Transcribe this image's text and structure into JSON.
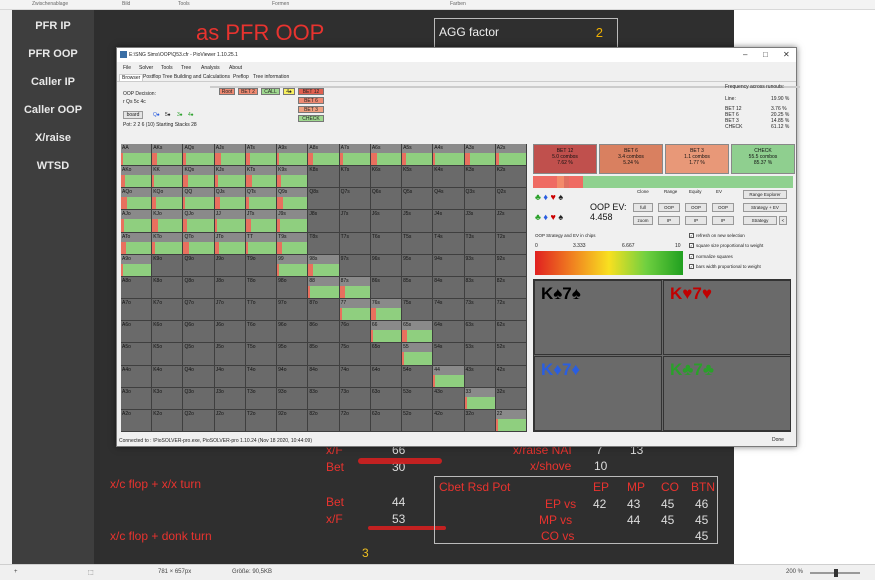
{
  "ribbon": {
    "items": [
      "Zwischenablage",
      "Bild",
      "Tools",
      "Formen",
      "Farben"
    ]
  },
  "left_nav": {
    "items": [
      "PFR IP",
      "PFR OOP",
      "Caller IP",
      "Caller OOP",
      "X/raise",
      "WTSD"
    ]
  },
  "slide": {
    "title": "as PFR OOP",
    "agg_label": "AGG factor",
    "agg_value": "2",
    "rows": [
      {
        "label": "x/F",
        "value": "66"
      },
      {
        "label": "Bet",
        "value": "30"
      },
      {
        "label": "Bet",
        "value": "44"
      },
      {
        "label": "x/F",
        "value": "53"
      }
    ],
    "raise_label": "x/raise NAI",
    "raise_value1": "7",
    "raise_value2": "13",
    "shove_label": "x/shove",
    "shove_value": "10",
    "line1": "x/c flop + x/x turn",
    "line2": "x/c flop + donk turn",
    "bottom_value": "3",
    "cbet_table": {
      "title": "Cbet Rsd Pot",
      "headers": [
        "EP",
        "MP",
        "CO",
        "BTN"
      ],
      "rows": [
        {
          "label": "EP vs",
          "values": [
            "42",
            "43",
            "45",
            "46"
          ]
        },
        {
          "label": "MP vs",
          "values": [
            "",
            "44",
            "45",
            "45"
          ]
        },
        {
          "label": "CO vs",
          "values": [
            "",
            "",
            "",
            "45"
          ]
        }
      ]
    }
  },
  "window": {
    "title": "E:\\SNG Sims\\OOP\\Q53.cfr - PioViewer 1.10.25.1",
    "menu": [
      "File",
      "Solver",
      "Tools",
      "Tree",
      "Analysis",
      "About"
    ],
    "tabs": [
      "Browser",
      "Postflop Tree Building and Calculations",
      "Preflop",
      "Tree information"
    ],
    "oop_decision": "OOP Decision:",
    "board_text": "r Qs 5c 4c",
    "board_button": "board",
    "board_cards": [
      "Q♠",
      "5♠",
      "3♠",
      "4♠"
    ],
    "pot_text": "Pot: 2 2 6 (10) Starting Stacks 28",
    "tree": {
      "root": "Root",
      "bet2": "BET 2",
      "call": "CALL",
      "card": "4♠",
      "children": [
        "BET 12",
        "BET 6",
        "BET 3",
        "CHECK"
      ]
    },
    "frequency_title": "Frequency across runouts:",
    "frequencies": [
      {
        "label": "Line:",
        "value": "19.90 %"
      },
      {
        "label": "BET 12",
        "value": "3.76 %"
      },
      {
        "label": "BET 6",
        "value": "20.25 %"
      },
      {
        "label": "BET 3",
        "value": "14.85 %"
      },
      {
        "label": "CHECK",
        "value": "61.12 %"
      }
    ],
    "sizes": [
      {
        "name": "BET 12",
        "combos": "5.0 combos",
        "pct": "7.62 %",
        "color": "#c0504d"
      },
      {
        "name": "BET 6",
        "combos": "3.4 combos",
        "pct": "5.24 %",
        "color": "#d98060"
      },
      {
        "name": "BET 3",
        "combos": "1.1 combos",
        "pct": "1.77 %",
        "color": "#e89878"
      },
      {
        "name": "CHECK",
        "combos": "55.5 combos",
        "pct": "85.37 %",
        "color": "#8fcf8f"
      }
    ],
    "oop_ev_label": "OOP EV:",
    "oop_ev_value": "4.458",
    "headers": [
      "Clone",
      "Range",
      "Equity",
      "EV"
    ],
    "buttons": [
      "full",
      "OOP",
      "OOP",
      "OOP",
      "zoom",
      "IP",
      "IP",
      "IP"
    ],
    "range_explorer": "Range Explorer",
    "strategy_ev": "Strategy + EV",
    "strategy": "Strategy",
    "arrow": "<",
    "ev_chart_label": "OOP Strategy and EV in chips",
    "scale": [
      "0",
      "3.333",
      "6.667",
      "10"
    ],
    "checkboxes": [
      "refresh on new selection",
      "square size proportional to weight",
      "normalize squares",
      "bars width proportional to weight"
    ],
    "combos": [
      {
        "label": "K♠7♠",
        "color": "#000000"
      },
      {
        "label": "K♥7♥",
        "color": "#c00000"
      },
      {
        "label": "K♦7♦",
        "color": "#2a5ee0"
      },
      {
        "label": "K♣7♣",
        "color": "#2aa02a"
      }
    ],
    "connected": "Connected to : \\PioSOLVER-pro.exe, PioSOLVER-pro 1.10.24 (Nov 18 2020, 10:44:09)",
    "done": "Done"
  },
  "status_bar": {
    "size": "781 × 657px",
    "file_size": "Größe: 90,5KB",
    "zoom": "200 %"
  }
}
